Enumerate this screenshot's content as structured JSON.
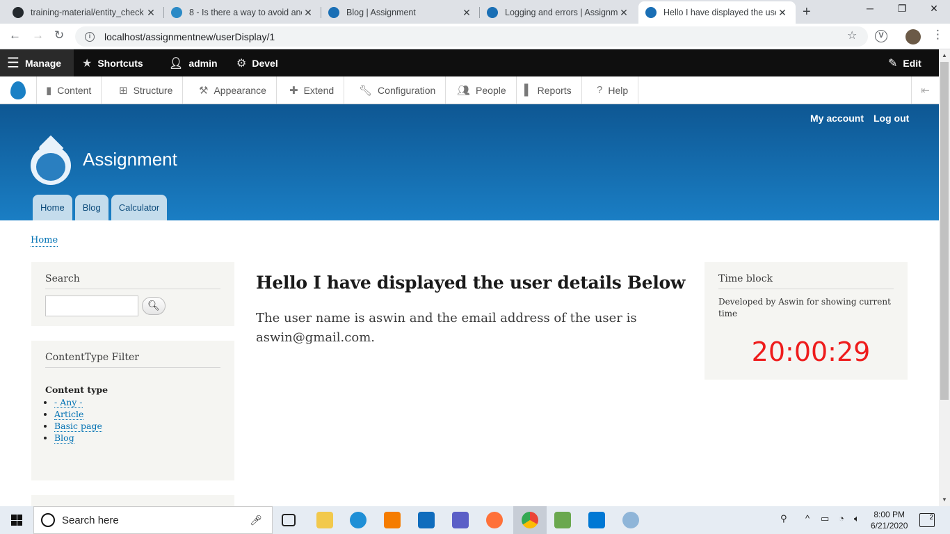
{
  "browser": {
    "tabs": [
      {
        "title": "training-material/entity_check…",
        "icon": "github-icon",
        "active": false
      },
      {
        "title": "8 - Is there a way to avoid anc…",
        "icon": "drupal-drop-icon",
        "active": false
      },
      {
        "title": "Blog | Assignment",
        "icon": "drupal-drop-icon",
        "active": false
      },
      {
        "title": "Logging and errors | Assignme…",
        "icon": "drupal-drop-icon",
        "active": false
      },
      {
        "title": "Hello I have displayed the user…",
        "icon": "drupal-drop-icon",
        "active": true
      }
    ],
    "url": "localhost/assignmentnew/userDisplay/1"
  },
  "toolbar": {
    "manage": "Manage",
    "shortcuts": "Shortcuts",
    "user": "admin",
    "devel": "Devel",
    "edit": "Edit",
    "menu": [
      "Content",
      "Structure",
      "Appearance",
      "Extend",
      "Configuration",
      "People",
      "Reports",
      "Help"
    ]
  },
  "header": {
    "site_name": "Assignment",
    "my_account": "My account",
    "log_out": "Log out",
    "tabs": [
      "Home",
      "Blog",
      "Calculator"
    ]
  },
  "breadcrumb": "Home",
  "search_block": {
    "title": "Search",
    "value": ""
  },
  "filter_block": {
    "title": "ContentType Filter",
    "label": "Content type",
    "options": [
      "- Any -",
      "Article",
      "Basic page",
      "Blog"
    ]
  },
  "main": {
    "title": "Hello I have displayed the user details Below",
    "body": "The user name is aswin and the email address of the user is aswin@gmail.com."
  },
  "time_block": {
    "title": "Time block",
    "description": "Developed by Aswin for showing current time",
    "time": "20:00:29",
    "time_color": "#ee1c1c"
  },
  "taskbar": {
    "search_placeholder": "Search here",
    "time": "8:00 PM",
    "date": "6/21/2020",
    "notifications": "2"
  },
  "colors": {
    "header_top": "#0e5793",
    "header_bottom": "#1a7ec4",
    "link": "#0071b3"
  }
}
